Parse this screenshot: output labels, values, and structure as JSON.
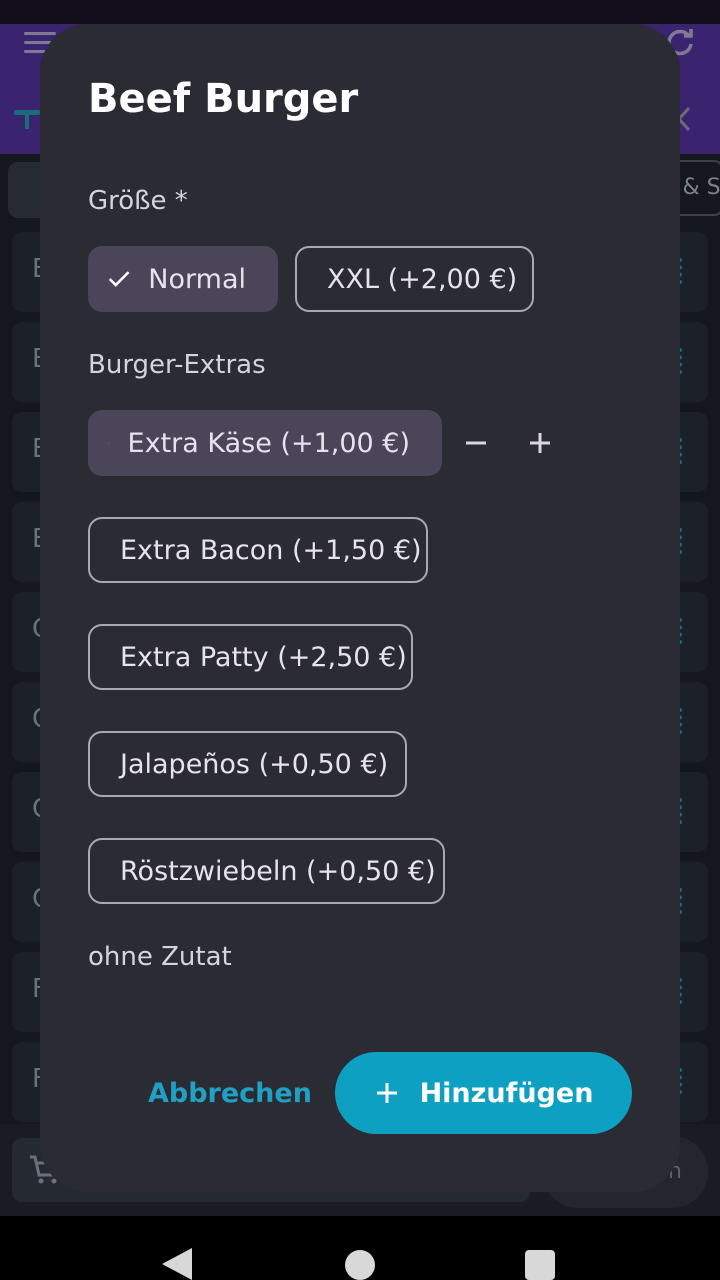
{
  "background": {
    "chip_right_text": "e & S",
    "row_letters": [
      "E",
      "E",
      "E",
      "E",
      "C",
      "C",
      "C",
      "C",
      "F",
      "F"
    ],
    "order_button_text": "en"
  },
  "dialog": {
    "title": "Beef Burger",
    "size_label": "Größe *",
    "size_options": [
      {
        "label": "Normal",
        "selected": true
      },
      {
        "label": "XXL (+2,00 €)",
        "selected": false
      }
    ],
    "extras_label": "Burger-Extras",
    "extras": [
      {
        "label": "Extra Käse (+1,00 €)",
        "selected": true
      },
      {
        "label": "Extra Bacon (+1,50 €)",
        "selected": false
      },
      {
        "label": "Extra Patty (+2,50 €)",
        "selected": false
      },
      {
        "label": "Jalapeños (+0,50 €)",
        "selected": false
      },
      {
        "label": "Röstzwiebeln (+0,50 €)",
        "selected": false
      }
    ],
    "without_label": "ohne Zutat",
    "cancel_label": "Abbrechen",
    "add_label": "Hinzufügen"
  },
  "colors": {
    "accent": "#0ea0c3",
    "dialog_bg": "#2a2b33",
    "selected_chip": "#4a4559",
    "topbar": "#3a2470"
  }
}
